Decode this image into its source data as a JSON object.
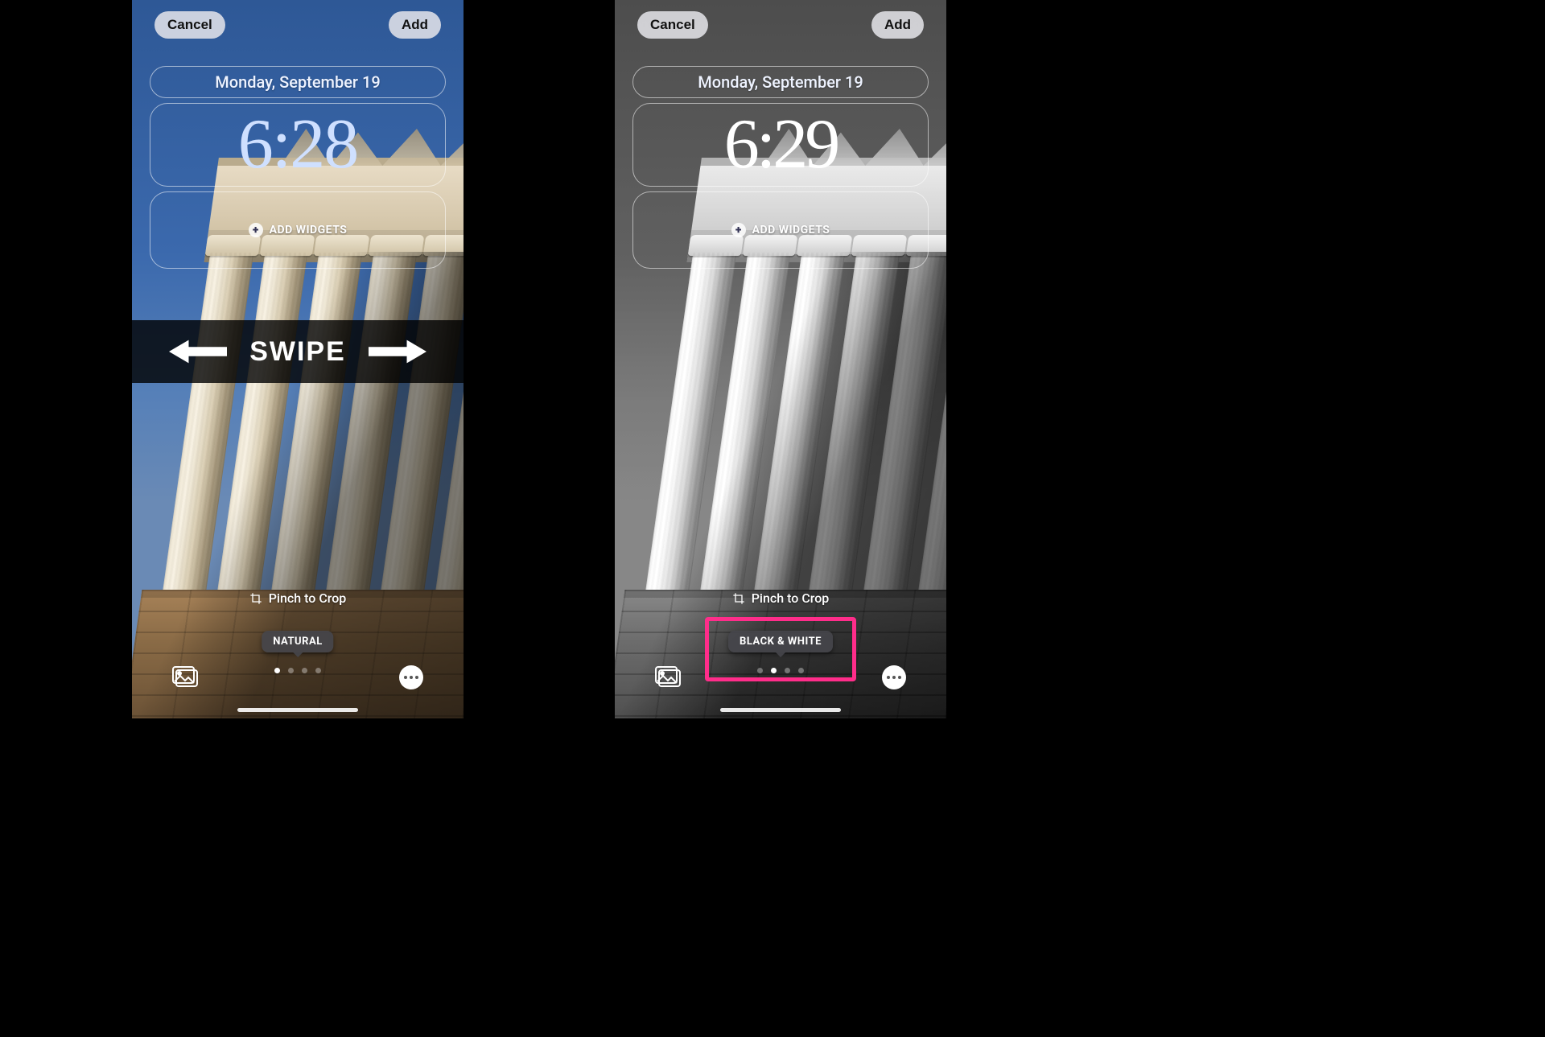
{
  "left": {
    "cancel": "Cancel",
    "add": "Add",
    "date": "Monday, September 19",
    "time": "6:28",
    "add_widgets": "ADD WIDGETS",
    "swipe": "SWIPE",
    "pinch": "Pinch to Crop",
    "filter": "NATURAL",
    "active_dot_index": 0,
    "dot_count": 4
  },
  "right": {
    "cancel": "Cancel",
    "add": "Add",
    "date": "Monday, September 19",
    "time": "6:29",
    "add_widgets": "ADD WIDGETS",
    "pinch": "Pinch to Crop",
    "filter": "BLACK & WHITE",
    "active_dot_index": 1,
    "dot_count": 4
  }
}
